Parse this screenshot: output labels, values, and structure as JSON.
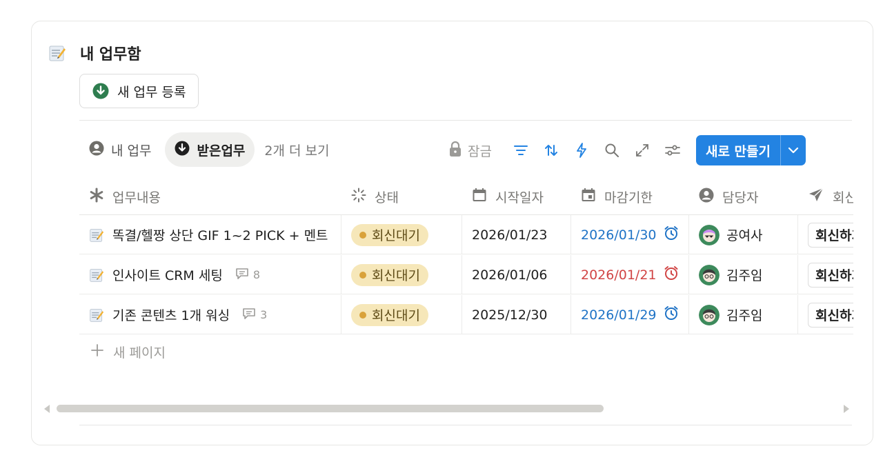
{
  "page": {
    "title": "내 업무함",
    "new_task_label": "새 업무 등록"
  },
  "views": {
    "tabs": [
      {
        "label": "내 업무",
        "icon": "person-circle-icon",
        "active": false
      },
      {
        "label": "받은업무",
        "icon": "down-arrow-circle-icon",
        "active": true
      }
    ],
    "more_label": "2개 더 보기"
  },
  "toolbar": {
    "lock_label": "잠금",
    "tools": [
      "filter-icon",
      "sort-icon",
      "automation-bolt-icon",
      "search-icon",
      "expand-icon",
      "settings-sliders-icon"
    ],
    "new_label": "새로 만들기"
  },
  "columns": [
    {
      "label": "업무내용",
      "icon": "asterisk-icon"
    },
    {
      "label": "상태",
      "icon": "status-spinner-icon"
    },
    {
      "label": "시작일자",
      "icon": "calendar-icon"
    },
    {
      "label": "마감기한",
      "icon": "calendar-due-icon"
    },
    {
      "label": "담당자",
      "icon": "person-icon"
    },
    {
      "label": "회신",
      "icon": "send-icon"
    }
  ],
  "rows": [
    {
      "name": "똑결/헬짱 상단 GIF 1~2 PICK + 멘트",
      "comments": "",
      "status": "회신대기",
      "start": "2026/01/23",
      "due": "2026/01/30",
      "due_color": "blue",
      "assignee": "공여사",
      "avatar": "purple-hair",
      "reply": "회신하기"
    },
    {
      "name": "인사이트 CRM 세팅",
      "comments": "8",
      "status": "회신대기",
      "start": "2026/01/06",
      "due": "2026/01/21",
      "due_color": "red",
      "assignee": "김주임",
      "avatar": "dark-hair",
      "reply": "회신하기"
    },
    {
      "name": "기존 콘텐츠 1개 워싱",
      "comments": "3",
      "status": "회신대기",
      "start": "2025/12/30",
      "due": "2026/01/29",
      "due_color": "blue",
      "assignee": "김주임",
      "avatar": "dark-hair",
      "reply": "회신하기"
    }
  ],
  "new_page_label": "새 페이지",
  "colors": {
    "accent": "#2383e2",
    "status_bg": "#f6e7b9",
    "status_dot": "#d9a23a",
    "due_blue": "#1f73c6",
    "due_red": "#d14545",
    "green_button": "#2e7d4f"
  }
}
